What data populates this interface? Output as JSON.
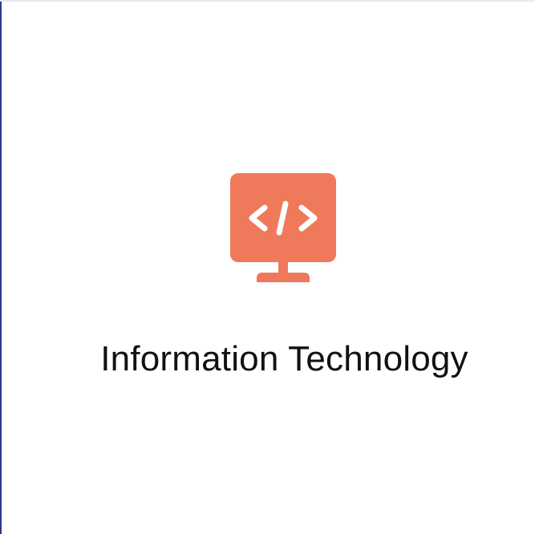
{
  "card": {
    "title": "Information Technology",
    "icon": "code-monitor-icon",
    "accent_color": "#ef7a5b"
  }
}
